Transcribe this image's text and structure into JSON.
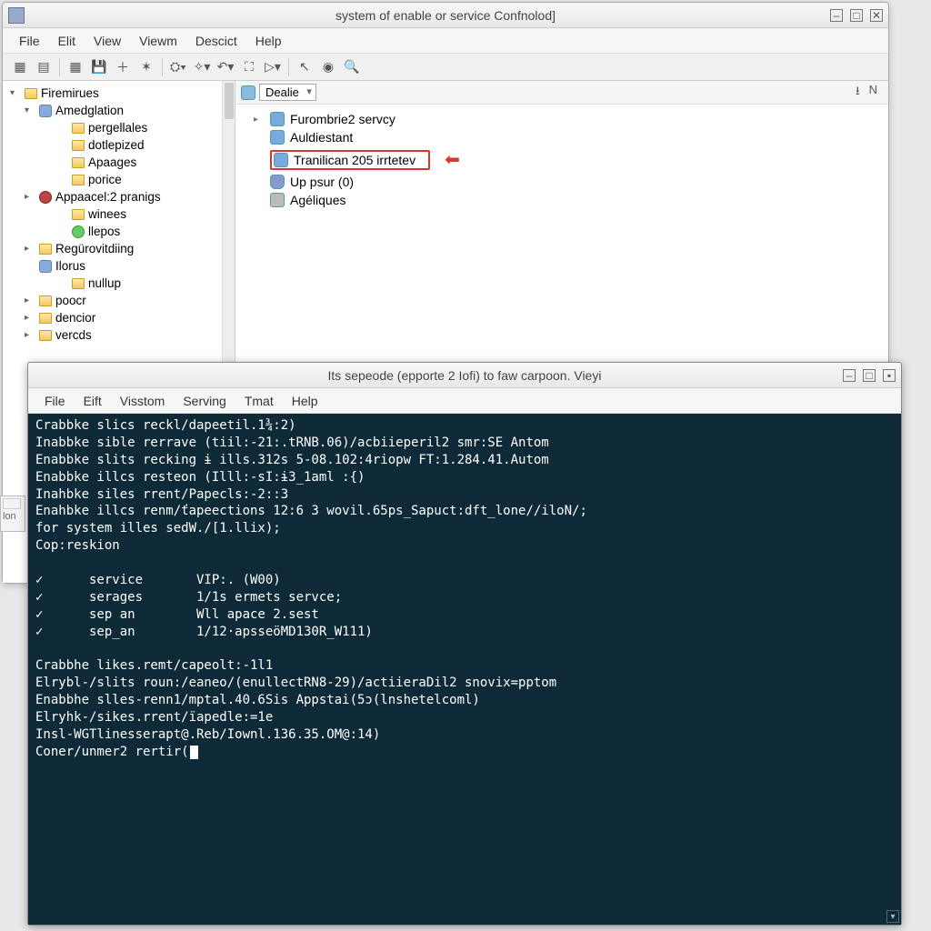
{
  "mainWindow": {
    "title": "system of enable or service Confnolod]",
    "menus": [
      "File",
      "Elit",
      "View",
      "Viewm",
      "Descict",
      "Help"
    ],
    "toolbarIcons": [
      "new",
      "open",
      "grid",
      "save",
      "plus",
      "refresh",
      "gear",
      "wiz",
      "undo",
      "redo",
      "run",
      "tool",
      "cfg",
      "arrow",
      "globe",
      "search"
    ],
    "sidebar": {
      "root": "Firemirues",
      "items": [
        {
          "label": "Amedglation",
          "expander": "▾",
          "lvl": 1,
          "icon": "db"
        },
        {
          "label": "pergellales",
          "lvl": 2,
          "icon": "folder"
        },
        {
          "label": "dotlepized",
          "lvl": 2,
          "icon": "folder"
        },
        {
          "label": "Apaages",
          "lvl": 2,
          "icon": "folder"
        },
        {
          "label": "porice",
          "lvl": 2,
          "icon": "folder"
        },
        {
          "label": "Appaacel:2 pranigs",
          "expander": "▸",
          "lvl": 1,
          "icon": "gear"
        },
        {
          "label": "winees",
          "lvl": 2,
          "icon": "folder"
        },
        {
          "label": "llepos",
          "lvl": 2,
          "icon": "grn"
        },
        {
          "label": "Regürovitdiing",
          "expander": "▸",
          "lvl": 1,
          "icon": "folder"
        },
        {
          "label": "Ilorus",
          "lvl": 1,
          "icon": "db"
        },
        {
          "label": "nullup",
          "lvl": 2,
          "icon": "folder"
        },
        {
          "label": "poocr",
          "expander": "▸",
          "lvl": 1,
          "icon": "folder"
        },
        {
          "label": "dencior",
          "expander": "▸",
          "lvl": 1,
          "icon": "folder"
        },
        {
          "label": "vercds",
          "expander": "▸",
          "lvl": 1,
          "icon": "folder"
        }
      ]
    },
    "mainpane": {
      "crumbLabel": "Dealie",
      "rightIcons": [
        "⭳",
        "N"
      ],
      "services": [
        {
          "label": "Furombrie2 servcy",
          "expander": "▸",
          "icon": "blue"
        },
        {
          "label": "Auldiestant",
          "icon": "blue"
        },
        {
          "label": "Tranilican 205 irrtetev",
          "icon": "blue",
          "highlight": true
        },
        {
          "label": "Up psur (0)",
          "icon": "cyl"
        },
        {
          "label": "Agéliques",
          "icon": "gear"
        }
      ]
    },
    "windowControls": {
      "min": "–",
      "max": "□",
      "close": "✕"
    }
  },
  "termWindow": {
    "title": "Its sepeode (epporte 2 Iofi) to faw carpoon. Vieyi",
    "menus": [
      "File",
      "Eift",
      "Visstom",
      "Serving",
      "Tmat",
      "Help"
    ],
    "lines": [
      "Crabbke slics reckl/dapeetil.1¾:2)",
      "Inabbke sible rerrave (tiil:-21:.tRNB.06)/acbiieperil2 smr:SE Antom",
      "Enabbke slits recking ɨ ills.312s 5-08.102:4riopw FT:1.284.41.Autom",
      "Enabbke illcs resteon (Illl:-sI:ɨ3_1aml :{)",
      "Inahbke siles rrent/Papecls:-2::3",
      "Enahbke illcs renm/ťapeections 12:6 3 wovil.65ps_Sapuct:dft_lone//iloN/;",
      "for system illes sedW./[1.llix);",
      "Cop:reskion",
      "",
      "✓      service       VIP:. (W00)",
      "✓      serages       1/1s ermets servce;",
      "✓      sep an        Wll apace 2.sest",
      "✓      sep_an        1/12·apsseöMD130R_W111)",
      "",
      "Crabbhe likes.remt/capeolt:-1l1",
      "Elrybl-/slits roun:/eaneo/(enullectRN8-29)/actiieraDil2 snovix=pptom",
      "Enabbhe slles-renn1/mptal.40.6Sis Appstai(5ɔ(lnshetelcoml)",
      "Elryhk-/sikes.rrent/ïapedle:=1e",
      "Insl-WGTlinesserapt@.Reb/Iownl.136.35.OM@:14)",
      "Coner/unmer2 rertir("
    ],
    "windowControls": {
      "min": "–",
      "max": "□",
      "close": "▪"
    }
  },
  "leftEdgeLabel": "lon"
}
